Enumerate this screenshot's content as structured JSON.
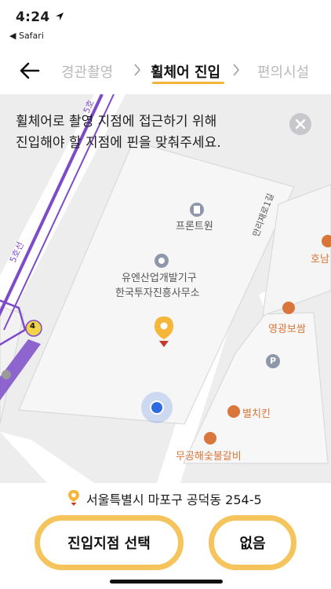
{
  "status_bar": {
    "time": "4:24",
    "back_app": "◀ Safari"
  },
  "header": {
    "steps": [
      {
        "label": "경관촬영",
        "state": "inactive"
      },
      {
        "label": "휠체어 진입",
        "state": "active"
      },
      {
        "label": "편의시설",
        "state": "inactive"
      }
    ]
  },
  "map": {
    "instruction_line1": "휠체어로 촬영 지점에 접근하기 위해",
    "instruction_line2": "진입해야 할 지점에 핀을 맞춰주세요.",
    "pois": {
      "front_one": "프론트원",
      "yuen_line1": "유엔산업개발기구",
      "yuen_line2": "한국투자진흥사무소",
      "yeonggwang": "영광보쌈",
      "byeolchikin": "별치킨",
      "mugong_galbi": "무공해숯불갈비",
      "honam": "호남"
    },
    "road_labels": {
      "mallijae": "만리재로1길",
      "line5_a": "5호선",
      "line5_b": "5호"
    },
    "subway_exit_number": "4",
    "parking_symbol": "P"
  },
  "address": "서울특별시 마포구 공덕동 254-5",
  "buttons": {
    "select_entry": "진입지점 선택",
    "none": "없음"
  },
  "colors": {
    "accent": "#f5c45c",
    "underline": "#f3b43a",
    "subway_line": "#7d4bc9",
    "poi_orange": "#d9763b",
    "user_dot": "#2f6be0"
  }
}
